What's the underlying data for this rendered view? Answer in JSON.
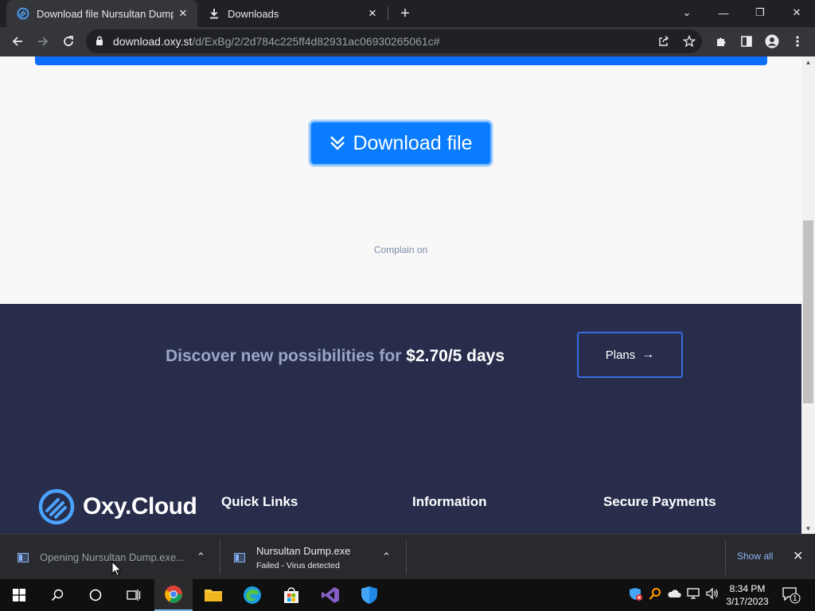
{
  "browser": {
    "tabs": [
      {
        "title": "Download file Nursultan Dump.e",
        "close": "✕"
      },
      {
        "title": "Downloads",
        "close": "✕"
      }
    ],
    "new_tab": "+",
    "window_controls": {
      "search_tabs": "⌄",
      "minimize": "—",
      "restore": "❐",
      "close": "✕"
    },
    "url_host": "download.oxy.st",
    "url_path": "/d/ExBg/2/2d784c225ff4d82931ac06930265061c#"
  },
  "page": {
    "download_button": "Download file",
    "complain": "Complain on",
    "promo_text": "Discover new possibilities for ",
    "promo_price": "$2.70/5 days",
    "plans_button": "Plans",
    "plans_arrow": "→",
    "logo_text": "Oxy.Cloud",
    "footer_headings": [
      "Quick Links",
      "Information",
      "Secure Payments"
    ]
  },
  "scrollbar": {
    "up": "▲",
    "down": "▼"
  },
  "download_shelf": {
    "items": [
      {
        "name": "Opening Nursultan Dump.exe...",
        "chevron": "⌃"
      },
      {
        "name": "Nursultan Dump.exe",
        "status": "Failed - Virus detected",
        "chevron": "⌃"
      }
    ],
    "show_all": "Show all",
    "close": "✕"
  },
  "taskbar": {
    "time": "8:34 PM",
    "date": "3/17/2023",
    "notification_count": "1"
  },
  "colors": {
    "accent_blue": "#0a7cff",
    "footer_bg": "#272d4b",
    "chrome_dark": "#202124"
  }
}
